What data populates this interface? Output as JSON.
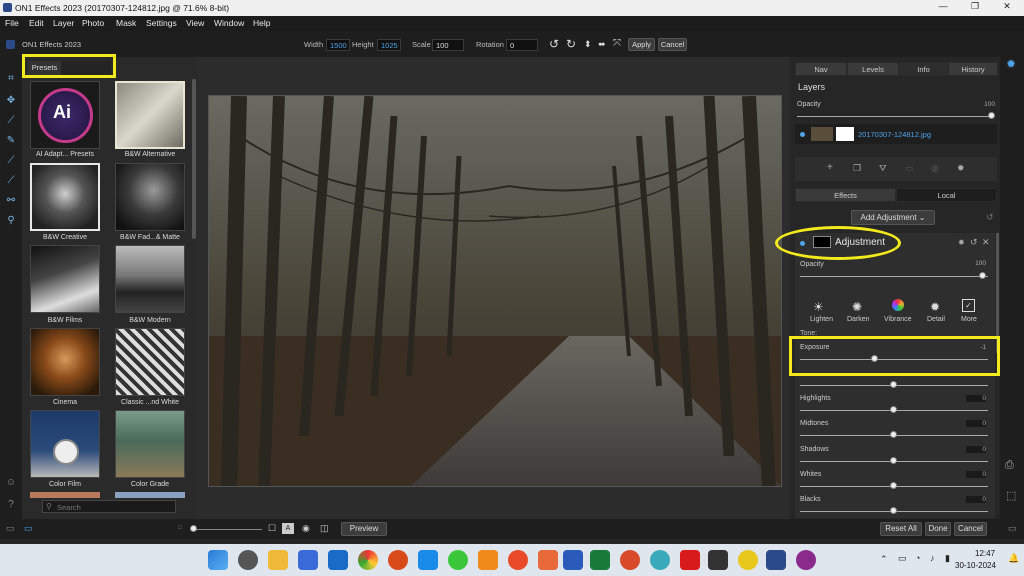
{
  "window": {
    "title": "ON1 Effects 2023 (20170307-124812.jpg @ 71.6% 8-bit)",
    "minimize": "—",
    "maximize": "❐",
    "close": "✕"
  },
  "menu": [
    "File",
    "Edit",
    "Layer",
    "Photo",
    "Mask",
    "Settings",
    "View",
    "Window",
    "Help"
  ],
  "appbar": {
    "app_name": "ON1 Effects 2023",
    "width_label": "Width",
    "width_value": "1500",
    "height_label": "Height",
    "height_value": "1025",
    "scale_label": "Scale",
    "scale_value": "100",
    "rotation_label": "Rotation",
    "rotation_value": "0",
    "apply": "Apply",
    "cancel": "Cancel"
  },
  "presets": {
    "tab_label": "Presets",
    "items": [
      {
        "label": "AI Adapt... Presets"
      },
      {
        "label": "B&W Alternative"
      },
      {
        "label": "B&W Creative"
      },
      {
        "label": "B&W Fad...& Matte"
      },
      {
        "label": "B&W Films"
      },
      {
        "label": "B&W Modern"
      },
      {
        "label": "Cinema"
      },
      {
        "label": "Classic ...nd White"
      },
      {
        "label": "Color Film"
      },
      {
        "label": "Color Grade"
      }
    ],
    "ai_text": "Ai",
    "search_placeholder": "Search"
  },
  "right": {
    "tabs": [
      "Nav",
      "Levels",
      "Info",
      "History"
    ],
    "layers_title": "Layers",
    "opacity_label": "Opacity",
    "opacity_value": "100",
    "layer_name": "20170307-124812.jpg",
    "mode_tabs": [
      "Effects",
      "Local"
    ],
    "add_adjustment": "Add Adjustment",
    "adjustment_title": "Adjustment",
    "adj_opacity_label": "Opacity",
    "adj_opacity_value": "100",
    "tools": [
      "Lighten",
      "Darken",
      "Vibrance",
      "Detail",
      "More"
    ],
    "tone_label": "Tone:",
    "sliders": [
      {
        "label": "Exposure",
        "value": "-1",
        "level": 0.4
      },
      {
        "label": "Highlights",
        "value": "0",
        "level": 0.5
      },
      {
        "label": "Midtones",
        "value": "0",
        "level": 0.5
      },
      {
        "label": "Shadows",
        "value": "0",
        "level": 0.5
      },
      {
        "label": "Whites",
        "value": "0",
        "level": 0.5
      },
      {
        "label": "Blacks",
        "value": "0",
        "level": 0.5
      }
    ]
  },
  "bottom": {
    "preview": "Preview",
    "reset_all": "Reset All",
    "done": "Done",
    "cancel": "Cancel"
  },
  "taskbar": {
    "time": "12:47",
    "date": "30-10-2024"
  },
  "colors": {
    "accent": "#4fa3e8",
    "highlight": "#f3ea1d"
  }
}
